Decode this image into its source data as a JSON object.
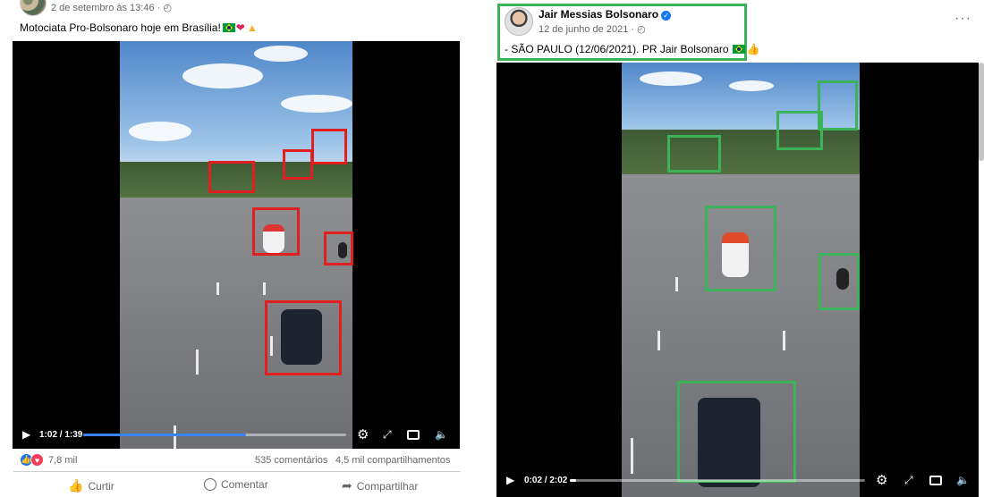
{
  "left_post": {
    "timestamp": "2 de setembro às 13:46 · ",
    "globe_icon": "globe-icon",
    "caption": "Motociata Pro-Bolsonaro hoje em Brasília!",
    "caption_emojis": [
      "brazil-flag-icon",
      "red-heart-icon",
      "praying-hands-icon"
    ],
    "video": {
      "time": "1:02 / 1:39",
      "progress": 0.62,
      "accent": "#3b82f6"
    },
    "detection_color": "#e0201f",
    "reactions": {
      "count": "7,8 mil",
      "icons": [
        "like-icon",
        "love-icon"
      ]
    },
    "comments": "535 comentários",
    "shares": "4,5 mil compartilhamentos",
    "actions": {
      "like": "Curtir",
      "comment": "Comentar",
      "share": "Compartilhar"
    }
  },
  "right_post": {
    "author": "Jair Messias Bolsonaro",
    "verified_icon": "verified-badge-icon",
    "timestamp": "12 de junho de 2021 · ",
    "globe_icon": "globe-icon",
    "caption": "- SÃO PAULO (12/06/2021). PR Jair Bolsonaro",
    "caption_emojis": [
      "brazil-flag-icon",
      "thumbs-up-icon"
    ],
    "video": {
      "time": "0:02 / 2:02",
      "progress": 0.02
    },
    "detection_color": "#3cb35a",
    "highlight_color": "#3cb35a"
  }
}
